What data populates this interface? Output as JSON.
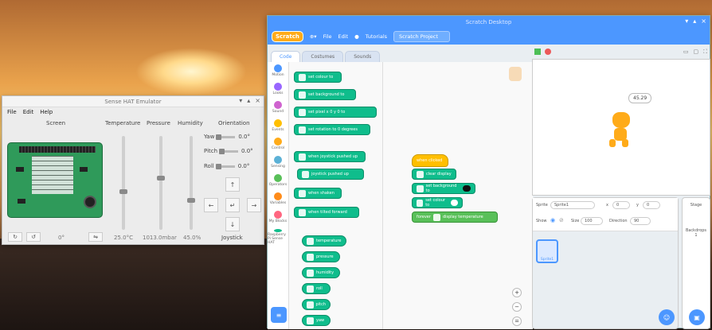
{
  "sense_window": {
    "title": "Sense HAT Emulator",
    "menu": [
      "File",
      "Edit",
      "Help"
    ],
    "columns": {
      "screen": "Screen",
      "temperature": "Temperature",
      "pressure": "Pressure",
      "humidity": "Humidity",
      "orientation": "Orientation"
    },
    "orientation": [
      {
        "label": "Yaw",
        "value": "0.0°"
      },
      {
        "label": "Pitch",
        "value": "0.0°"
      },
      {
        "label": "Roll",
        "value": "0.0°"
      }
    ],
    "readouts": {
      "rotation": "0°",
      "temperature": "25.0°C",
      "pressure": "1013.0mbar",
      "humidity": "45.0%",
      "joystick": "Joystick"
    },
    "slider_levels": {
      "temperature": 0.4,
      "pressure": 0.55,
      "humidity": 0.3
    },
    "joystick_arrows": {
      "up": "↑",
      "left": "←",
      "center": "↵",
      "right": "→",
      "down": "↓"
    }
  },
  "scratch_window": {
    "title": "Scratch Desktop",
    "logo": "Scratch",
    "menu": {
      "file": "File",
      "edit": "Edit",
      "tutorials": "Tutorials",
      "project_title": "Scratch Project"
    },
    "tabs": [
      "Code",
      "Costumes",
      "Sounds"
    ],
    "categories": [
      {
        "label": "Motion",
        "color": "#4c97ff"
      },
      {
        "label": "Looks",
        "color": "#9966ff"
      },
      {
        "label": "Sound",
        "color": "#cf63cf"
      },
      {
        "label": "Events",
        "color": "#ffbf00"
      },
      {
        "label": "Control",
        "color": "#ffab19"
      },
      {
        "label": "Sensing",
        "color": "#5cb1d6"
      },
      {
        "label": "Operators",
        "color": "#59c059"
      },
      {
        "label": "Variables",
        "color": "#ff8c1a"
      },
      {
        "label": "My Blocks",
        "color": "#ff6680"
      },
      {
        "label": "Raspberry Pi Sense HAT",
        "color": "#0fbd8c"
      }
    ],
    "palette_blocks": [
      "set colour to",
      "set background to",
      "set pixel x 0 y 0 to",
      "set rotation to 0 degrees",
      "when joystick pushed up",
      "joystick pushed up",
      "when shaken",
      "when tilted forward",
      "temperature",
      "pressure",
      "humidity",
      "roll",
      "pitch",
      "yaw"
    ],
    "script": {
      "hat": "when clicked",
      "blocks": [
        "clear display",
        "set background to",
        "set colour to",
        "display temperature"
      ],
      "loop": "forever"
    },
    "speech_bubble": "45.29",
    "sprite_panel": {
      "sprite_label": "Sprite",
      "sprite_name": "Sprite1",
      "x_label": "x",
      "x_value": "0",
      "y_label": "y",
      "y_value": "0",
      "show_label": "Show",
      "size_label": "Size",
      "size_value": "100",
      "direction_label": "Direction",
      "direction_value": "90",
      "tile_label": "Sprite1"
    },
    "stage_panel": {
      "title": "Stage",
      "backdrops_label": "Backdrops",
      "backdrops_count": "1"
    }
  }
}
